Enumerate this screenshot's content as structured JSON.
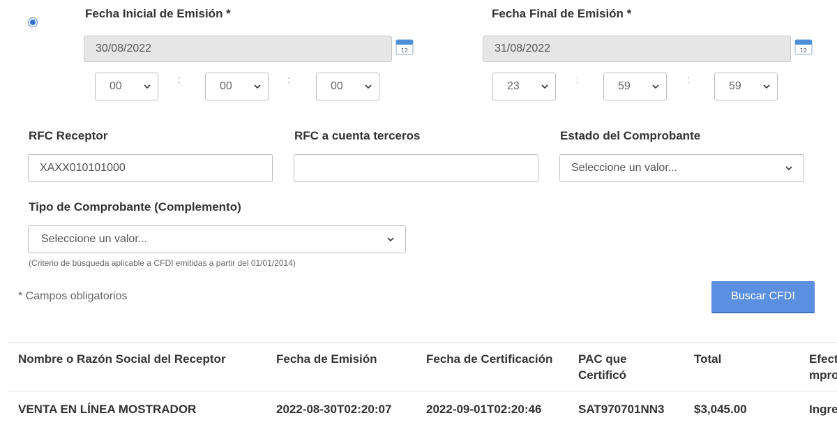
{
  "fecha_inicial": {
    "label": "Fecha Inicial de Emisión *",
    "value": "30/08/2022",
    "hour": "00",
    "minute": "00",
    "second": "00"
  },
  "fecha_final": {
    "label": "Fecha Final de Emisión *",
    "value": "31/08/2022",
    "hour": "23",
    "minute": "59",
    "second": "59"
  },
  "time_separator": ":",
  "calendar_day": "12",
  "rfc_receptor": {
    "label": "RFC Receptor",
    "value": "XAXX010101000"
  },
  "rfc_terceros": {
    "label": "RFC a cuenta terceros",
    "value": ""
  },
  "estado": {
    "label": "Estado del Comprobante",
    "selected": "Seleccione un valor..."
  },
  "tipo": {
    "label": "Tipo de Comprobante (Complemento)",
    "selected": "Seleccione un valor..."
  },
  "hint": "(Criterio de búsqueda aplicable a CFDI emitidas a partir del 01/01/2014)",
  "required_note": "* Campos obligatorios",
  "search_button": "Buscar CFDI",
  "table": {
    "headers": [
      "Nombre o Razón Social del Receptor",
      "Fecha de Emisión",
      "Fecha de Certificación",
      "PAC que Certificó",
      "Total",
      "Efecto del Comprobante"
    ],
    "rows": [
      [
        "VENTA EN LÍNEA MOSTRADOR",
        "2022-08-30T02:20:07",
        "2022-09-01T02:20:46",
        "SAT970701NN3",
        "$3,045.00",
        "Ingreso"
      ]
    ]
  }
}
